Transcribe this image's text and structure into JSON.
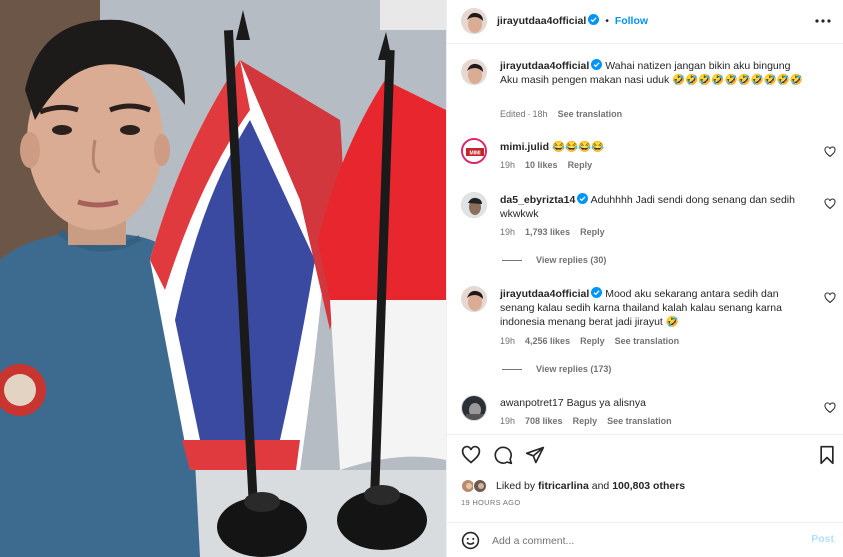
{
  "header": {
    "username": "jirayutdaa4official",
    "follow_label": "Follow",
    "more_icon": "more-horizontal-icon"
  },
  "caption": {
    "username": "jirayutdaa4official",
    "text": "Wahai natizen jangan bikin aku bingung Aku masih pengen makan nasi uduk 🤣🤣🤣🤣🤣🤣🤣🤣🤣🤣",
    "edited": "Edited",
    "time": "18h",
    "see_translation": "See translation"
  },
  "comments": [
    {
      "username": "mimi.julid",
      "text": "😂😂😂😂",
      "time": "19h",
      "likes": "10 likes",
      "reply": "Reply"
    },
    {
      "username": "da5_ebyrizta14",
      "verified": true,
      "text": "Aduhhhh Jadi sendi dong senang dan sedih wkwkwk",
      "time": "19h",
      "likes": "1,793 likes",
      "reply": "Reply",
      "view_replies": "View replies (30)"
    },
    {
      "username": "jirayutdaa4official",
      "verified": true,
      "text": "Mood aku sekarang antara sedih dan senang kalau sedih karna thailand kalah kalau senang karna indonesia menang berat jadi jirayut 🤣",
      "time": "19h",
      "likes": "4,256 likes",
      "reply": "Reply",
      "see_translation": "See translation",
      "view_replies": "View replies (173)"
    },
    {
      "username": "awanpotret17",
      "text": "Bagus ya alisnya",
      "time": "19h",
      "likes": "708 likes",
      "reply": "Reply",
      "see_translation": "See translation"
    }
  ],
  "actions": {
    "liked_by_prefix": "Liked by",
    "liked_by_user": "fitricarlina",
    "liked_by_and": "and",
    "liked_by_others": "100,803 others",
    "time_ago": "19 HOURS AGO"
  },
  "comment_box": {
    "placeholder": "Add a comment...",
    "post_label": "Post"
  },
  "colors": {
    "accent": "#0095f6",
    "muted": "#737373",
    "thai_red": "#e03a3e",
    "thai_blue": "#3a4aa0",
    "indo_red": "#e8262d"
  }
}
